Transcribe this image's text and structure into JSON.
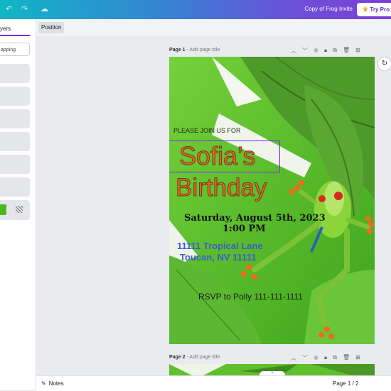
{
  "topbar": {
    "undo_icon": "undo-icon",
    "redo_icon": "redo-icon",
    "cloud_icon": "cloud-icon",
    "doc_title": "Copy of Frog Invite",
    "try_label": "Try Pro"
  },
  "left_panel": {
    "tab_label": "yers",
    "input_text": "apping"
  },
  "toolbar": {
    "position_label": "Position"
  },
  "pages": [
    {
      "label": "Page 1",
      "placeholder": "- Add page title"
    },
    {
      "label": "Page 2",
      "placeholder": "- Add page title"
    }
  ],
  "invite": {
    "intro": "PLEASE JOIN US FOR",
    "name": "Sofia’s",
    "occasion": "Birthday",
    "date": "Saturday, August 5th, 2023",
    "time": "1:00 PM",
    "address1": "11111 Tropical Lane",
    "address2": "Toucan, NV 11111",
    "rsvp": "RSVP to Polly 111-111-1111"
  },
  "footer": {
    "notes_label": "Notes",
    "page_count": "Page 1 / 2"
  },
  "colors": {
    "brand_start": "#10b6c6",
    "brand_end": "#7b3fd6",
    "selection": "#7d2ae8",
    "name_fill": "#e8652a",
    "name_outline": "#6a3c12",
    "address": "#3f5bd0",
    "background_green": "#5fc12f"
  }
}
